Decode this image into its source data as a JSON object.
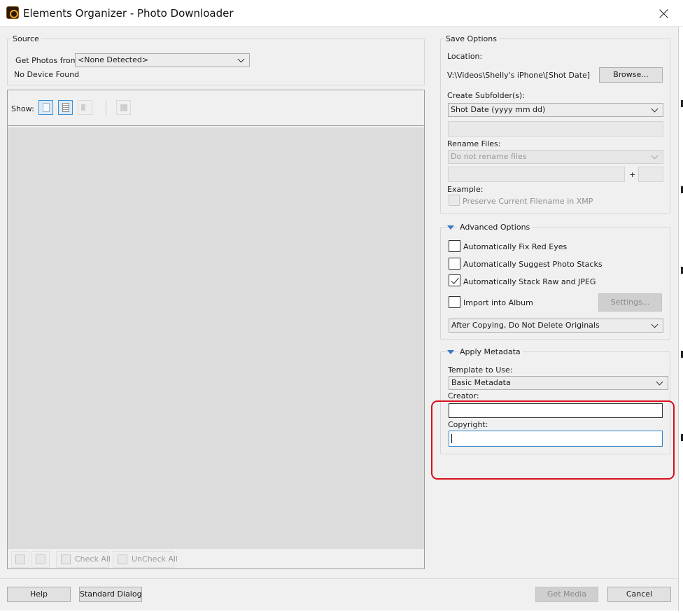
{
  "window": {
    "title": "Elements Organizer - Photo Downloader"
  },
  "source": {
    "group_title": "Source",
    "get_photos_label": "Get Photos from:",
    "get_photos_value": "<None Detected>",
    "status": "No Device Found"
  },
  "viewer": {
    "show_label": "Show:",
    "check_all": "Check All",
    "uncheck_all": "UnCheck All"
  },
  "save_options": {
    "group_title": "Save Options",
    "location_label": "Location:",
    "location_value": "V:\\Videos\\Shelly's iPhone\\[Shot Date]",
    "browse_label": "Browse...",
    "subfolder_label": "Create Subfolder(s):",
    "subfolder_value": "Shot Date (yyyy mm dd)",
    "rename_label": "Rename Files:",
    "rename_value": "Do not rename files",
    "plus": "+",
    "example_label": "Example:",
    "preserve_label": "Preserve Current Filename in XMP",
    "preserve_checked": false
  },
  "advanced": {
    "group_title": "Advanced Options",
    "fix_red_eyes": {
      "label": "Automatically Fix Red Eyes",
      "checked": false
    },
    "suggest_stacks": {
      "label": "Automatically Suggest Photo Stacks",
      "checked": false
    },
    "stack_raw_jpeg": {
      "label": "Automatically Stack Raw and JPEG",
      "checked": true
    },
    "import_album": {
      "label": "Import into Album",
      "checked": false
    },
    "settings_label": "Settings...",
    "after_copying_value": "After Copying, Do Not Delete Originals"
  },
  "metadata": {
    "group_title": "Apply Metadata",
    "template_label": "Template to Use:",
    "template_value": "Basic Metadata",
    "creator_label": "Creator:",
    "creator_value": "",
    "copyright_label": "Copyright:",
    "copyright_value": ""
  },
  "footer": {
    "help": "Help",
    "standard_dialog": "Standard Dialog",
    "get_media": "Get Media",
    "cancel": "Cancel"
  },
  "colors": {
    "annotation": "#d8101a",
    "focus_border": "#2a7fc9",
    "selection_blue": "#3c8fd6"
  },
  "icons": [
    "app-logo-icon",
    "close-icon",
    "photo-view-icon",
    "list-view-icon",
    "speaker-icon",
    "import-icon",
    "rotate-left-icon",
    "rotate-right-icon",
    "check-all-icon",
    "uncheck-all-icon",
    "expand-triangle-icon",
    "dropdown-chevron-icon"
  ]
}
